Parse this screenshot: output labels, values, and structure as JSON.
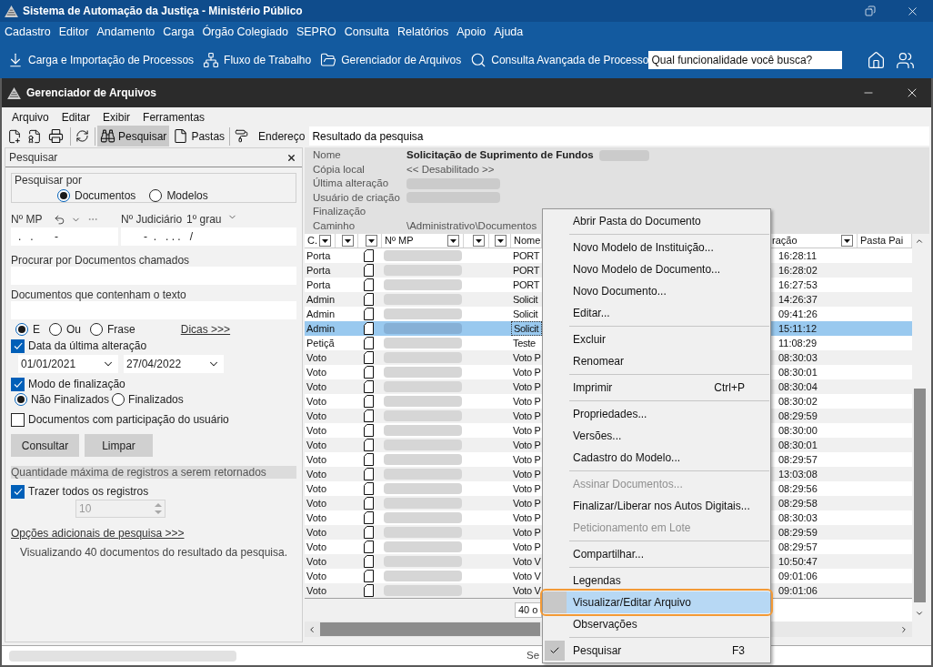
{
  "app_window": {
    "title": "Sistema de Automação da Justiça - Ministério Público"
  },
  "main_menu": [
    "Cadastro",
    "Editor",
    "Andamento",
    "Carga",
    "Órgão Colegiado",
    "SEPRO",
    "Consulta",
    "Relatórios",
    "Apoio",
    "Ajuda"
  ],
  "main_toolbar": {
    "buttons": [
      "Carga e Importação de Processos",
      "Fluxo de Trabalho",
      "Gerenciador de Arquivos",
      "Consulta Avançada de Processo"
    ],
    "search": {
      "placeholder": "Qual funcionalidade você busca?"
    }
  },
  "file_manager": {
    "title": "Gerenciador de Arquivos",
    "menu": [
      "Arquivo",
      "Editar",
      "Exibir",
      "Ferramentas"
    ],
    "toolbar": {
      "toggles": [
        {
          "label": "Pesquisar",
          "pressed": true
        },
        {
          "label": "Pastas",
          "pressed": false
        }
      ],
      "address": {
        "label": "Endereço",
        "value": "Resultado da pesquisa"
      }
    },
    "search_panel": {
      "title": "Pesquisar",
      "search_by": {
        "label": "Pesquisar por",
        "options": [
          {
            "label": "Documentos",
            "selected": true
          },
          {
            "label": "Modelos",
            "selected": false
          }
        ]
      },
      "mp_number": {
        "label": "Nº MP",
        "value": ".   .       -"
      },
      "judicial_number": {
        "label": "Nº Judiciário",
        "instance": "1º grau",
        "value": "-  .   . . .   /"
      },
      "name_field": {
        "label": "Procurar por Documentos chamados"
      },
      "text_field": {
        "label": "Documentos que contenham o texto"
      },
      "match_modes": [
        {
          "label": "E",
          "selected": true
        },
        {
          "label": "Ou",
          "selected": false
        },
        {
          "label": "Frase",
          "selected": false
        }
      ],
      "tips_link": "Dicas >>>",
      "date_filter": {
        "label": "Data da última alteração",
        "checked": true,
        "from": "01/01/2021",
        "to": "27/04/2022"
      },
      "finalization_filter": {
        "label": "Modo de finalização",
        "checked": true,
        "options": [
          {
            "label": "Não Finalizados",
            "selected": true
          },
          {
            "label": "Finalizados",
            "selected": false
          }
        ]
      },
      "participation_filter": {
        "label": "Documentos com participação do usuário",
        "checked": false
      },
      "buttons": [
        "Consultar",
        "Limpar"
      ],
      "limit": {
        "title": "Quantidade máxima de registros a serem retornados",
        "all_records": {
          "label": "Trazer todos os registros",
          "checked": true
        },
        "max_records": {
          "value": "10",
          "disabled": true
        }
      },
      "more_options_link": "Opções adicionais de pesquisa >>>",
      "summary": "Visualizando 40 documentos do resultado da pesquisa."
    },
    "details": [
      {
        "label": "Nome",
        "value": "Solicitação de Suprimento de Fundos",
        "redacted": true
      },
      {
        "label": "Cópia local",
        "value": "<< Desabilitado >>",
        "redacted": false
      },
      {
        "label": "Última alteração",
        "redacted": true
      },
      {
        "label": "Usuário de criação",
        "redacted": true
      },
      {
        "label": "Finalização",
        "redacted": false
      },
      {
        "label": "Caminho",
        "value": "\\Administrativo\\Documentos",
        "redacted": false
      }
    ],
    "table": {
      "columns": [
        {
          "label": "C.",
          "filter": true
        },
        {
          "filter": true
        },
        {
          "filter": true
        },
        {
          "label": "Nº MP",
          "filter": true
        },
        {
          "filter": true
        },
        {
          "filter": true
        },
        {
          "label": "Nome",
          "filter": false
        },
        {
          "label": "ração",
          "filter": true
        },
        {
          "label": "Pasta Pai",
          "filter": false
        }
      ],
      "number_redacted": true,
      "rows": [
        {
          "type": "Porta",
          "name": "PORT",
          "modified": "16:28:11",
          "selected": false
        },
        {
          "type": "Porta",
          "name": "PORT",
          "modified": "16:28:02",
          "selected": false
        },
        {
          "type": "Porta",
          "name": "PORT",
          "modified": "16:27:53",
          "selected": false
        },
        {
          "type": "Admin",
          "name": "Solicit",
          "modified": "14:26:37",
          "selected": false
        },
        {
          "type": "Admin",
          "name": "Solicit",
          "modified": "09:41:26",
          "selected": false
        },
        {
          "type": "Admin",
          "name": "Solicit",
          "modified": "15:11:12",
          "selected": true
        },
        {
          "type": "Petiçã",
          "name": "Teste",
          "modified": "11:08:29",
          "selected": false
        },
        {
          "type": "Voto",
          "name": "Voto P",
          "modified": "08:30:03",
          "selected": false
        },
        {
          "type": "Voto",
          "name": "Voto P",
          "modified": "08:30:01",
          "selected": false
        },
        {
          "type": "Voto",
          "name": "Voto P",
          "modified": "08:30:04",
          "selected": false
        },
        {
          "type": "Voto",
          "name": "Voto P",
          "modified": "08:30:02",
          "selected": false
        },
        {
          "type": "Voto",
          "name": "Voto P",
          "modified": "08:29:59",
          "selected": false
        },
        {
          "type": "Voto",
          "name": "Voto P",
          "modified": "08:30:00",
          "selected": false
        },
        {
          "type": "Voto",
          "name": "Voto P",
          "modified": "08:30:01",
          "selected": false
        },
        {
          "type": "Voto",
          "name": "Voto P",
          "modified": "08:29:57",
          "selected": false
        },
        {
          "type": "Voto",
          "name": "Voto P",
          "modified": "13:03:08",
          "selected": false
        },
        {
          "type": "Voto",
          "name": "Voto P",
          "modified": "08:29:56",
          "selected": false
        },
        {
          "type": "Voto",
          "name": "Voto P",
          "modified": "08:29:58",
          "selected": false
        },
        {
          "type": "Voto",
          "name": "Voto P",
          "modified": "08:30:03",
          "selected": false
        },
        {
          "type": "Voto",
          "name": "Voto P",
          "modified": "08:29:59",
          "selected": false
        },
        {
          "type": "Voto",
          "name": "Voto P",
          "modified": "08:29:57",
          "selected": false
        },
        {
          "type": "Voto",
          "name": "Voto V",
          "modified": "10:50:47",
          "selected": false
        },
        {
          "type": "Voto",
          "name": "Voto V",
          "modified": "09:01:06",
          "selected": false
        },
        {
          "type": "Voto",
          "name": "Voto V",
          "modified": "09:01:06",
          "selected": false
        }
      ],
      "count": "40 o"
    },
    "status_bar": {
      "redacted": true,
      "text": "Se"
    }
  },
  "context_menu": [
    {
      "kind": "item",
      "label": "Abrir Pasta do Documento",
      "disabled": false,
      "selected": false,
      "checked": false
    },
    {
      "kind": "separator"
    },
    {
      "kind": "item",
      "label": "Novo Modelo de Instituição...",
      "disabled": false,
      "selected": false,
      "checked": false
    },
    {
      "kind": "item",
      "label": "Novo Modelo de Documento...",
      "disabled": false,
      "selected": false,
      "checked": false
    },
    {
      "kind": "item",
      "label": "Novo Documento...",
      "disabled": false,
      "selected": false,
      "checked": false
    },
    {
      "kind": "item",
      "label": "Editar...",
      "disabled": false,
      "selected": false,
      "checked": false
    },
    {
      "kind": "separator"
    },
    {
      "kind": "item",
      "label": "Excluir",
      "disabled": false,
      "selected": false,
      "checked": false
    },
    {
      "kind": "item",
      "label": "Renomear",
      "disabled": false,
      "selected": false,
      "checked": false
    },
    {
      "kind": "separator"
    },
    {
      "kind": "item",
      "label": "Imprimir",
      "shortcut": "Ctrl+P",
      "disabled": false,
      "selected": false,
      "checked": false
    },
    {
      "kind": "separator"
    },
    {
      "kind": "item",
      "label": "Propriedades...",
      "disabled": false,
      "selected": false,
      "checked": false
    },
    {
      "kind": "item",
      "label": "Versões...",
      "disabled": false,
      "selected": false,
      "checked": false
    },
    {
      "kind": "item",
      "label": "Cadastro do Modelo...",
      "disabled": false,
      "selected": false,
      "checked": false
    },
    {
      "kind": "separator"
    },
    {
      "kind": "item",
      "label": "Assinar Documentos...",
      "disabled": true,
      "selected": false,
      "checked": false
    },
    {
      "kind": "item",
      "label": "Finalizar/Liberar nos Autos Digitais...",
      "disabled": false,
      "selected": false,
      "checked": false
    },
    {
      "kind": "item",
      "label": "Peticionamento em Lote",
      "disabled": true,
      "selected": false,
      "checked": false
    },
    {
      "kind": "separator"
    },
    {
      "kind": "item",
      "label": "Compartilhar...",
      "disabled": false,
      "selected": false,
      "checked": false
    },
    {
      "kind": "separator"
    },
    {
      "kind": "item",
      "label": "Legendas",
      "disabled": false,
      "selected": false,
      "checked": false
    },
    {
      "kind": "item",
      "label": "Visualizar/Editar Arquivo",
      "disabled": false,
      "selected": true,
      "checked": false
    },
    {
      "kind": "item",
      "label": "Observações",
      "disabled": false,
      "selected": false,
      "checked": false
    },
    {
      "kind": "separator"
    },
    {
      "kind": "item",
      "label": "Pesquisar",
      "shortcut": "F3",
      "disabled": false,
      "selected": false,
      "checked": true
    }
  ]
}
